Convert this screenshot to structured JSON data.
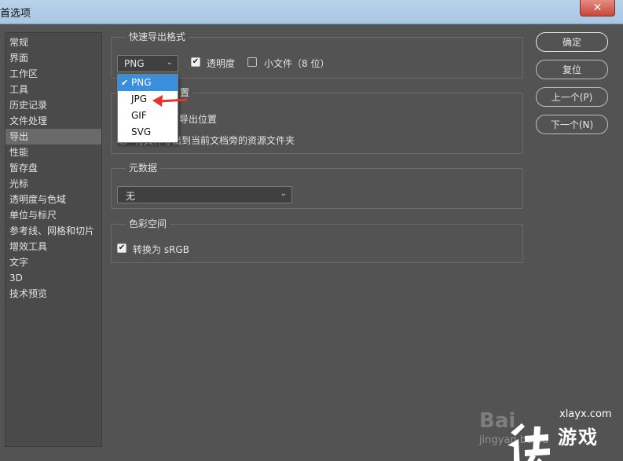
{
  "window": {
    "title": "首选项",
    "close_symbol": "✕"
  },
  "nav": {
    "items": [
      {
        "label": "常规"
      },
      {
        "label": "界面"
      },
      {
        "label": "工作区"
      },
      {
        "label": "工具"
      },
      {
        "label": "历史记录"
      },
      {
        "label": "文件处理"
      },
      {
        "label": "导出",
        "active": true
      },
      {
        "label": "性能"
      },
      {
        "label": "暂存盘"
      },
      {
        "label": "光标"
      },
      {
        "label": "透明度与色域"
      },
      {
        "label": "单位与标尺"
      },
      {
        "label": "参考线、网格和切片"
      },
      {
        "label": "增效工具"
      },
      {
        "label": "文字"
      },
      {
        "label": "3D"
      },
      {
        "label": "技术预览"
      }
    ]
  },
  "quick_export": {
    "title": "快速导出格式",
    "format_selected": "PNG",
    "transparency_label": "透明度",
    "transparency_checked": true,
    "small_file_label": "小文件（8 位）",
    "small_file_checked": false,
    "format_options": [
      "PNG",
      "JPG",
      "GIF",
      "SVG"
    ]
  },
  "export_location": {
    "title_suffix": "置",
    "option1_suffix": "导出位置",
    "option2_label": "将文件导出到当前文档旁的资源文件夹"
  },
  "metadata": {
    "title": "元数据",
    "selected": "无"
  },
  "color_space": {
    "title": "色彩空间",
    "convert_label": "转换为 sRGB",
    "convert_checked": true
  },
  "buttons": {
    "ok": "确定",
    "reset": "复位",
    "prev": "上一个(P)",
    "next": "下一个(N)"
  },
  "watermark": {
    "baidu": "Bai",
    "jingyan": "jingyan.baidu",
    "site": "xlayx.com",
    "game": "游戏"
  },
  "colors": {
    "panel_bg": "#535353",
    "highlight": "#3a8fdd",
    "annotation_arrow": "#e8322c"
  },
  "icons": {
    "dropdown": "chevron-down-icon",
    "check": "checkmark-icon",
    "close": "close-icon"
  }
}
